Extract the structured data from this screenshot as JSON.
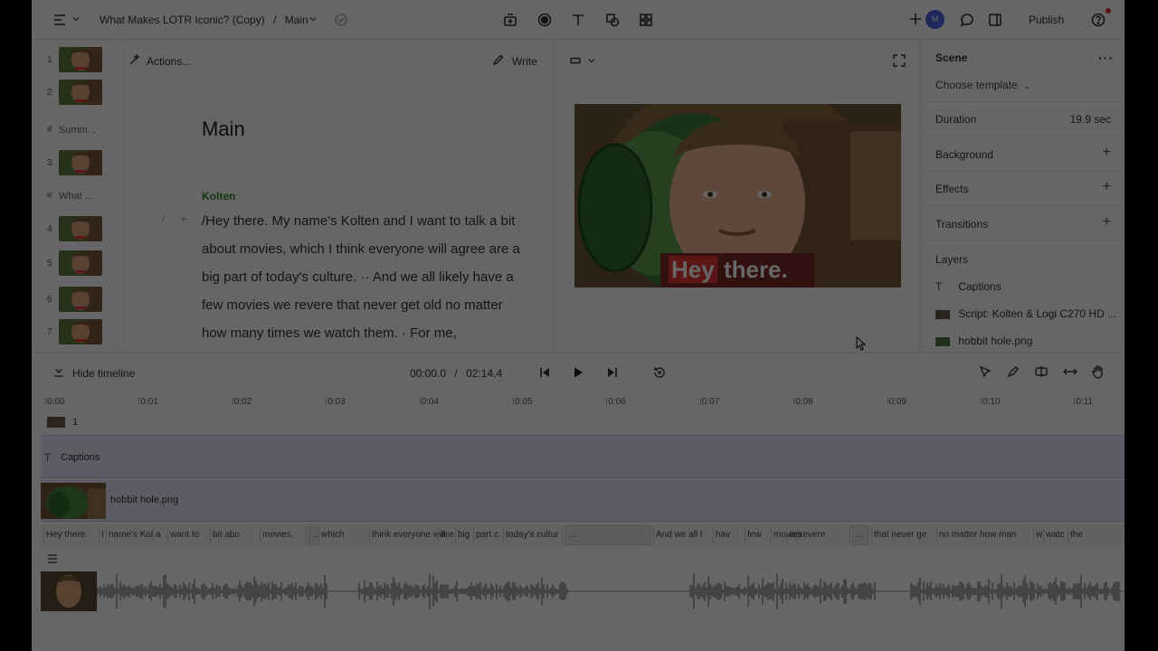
{
  "topbar": {
    "project_title": "What Makes LOTR Iconic? (Copy)",
    "separator": "/",
    "composition": "Main",
    "avatar_initial": "M",
    "publish_label": "Publish"
  },
  "thumbnails": [
    {
      "num": "1",
      "kind": "frame"
    },
    {
      "num": "2",
      "kind": "frame"
    },
    {
      "num": "#",
      "kind": "marker",
      "label": "Summ..."
    },
    {
      "num": "3",
      "kind": "frame"
    },
    {
      "num": "#",
      "kind": "marker",
      "label": "What ..."
    },
    {
      "num": "4",
      "kind": "frame"
    },
    {
      "num": "5",
      "kind": "frame"
    },
    {
      "num": "6",
      "kind": "frame"
    },
    {
      "num": "7",
      "kind": "frame"
    }
  ],
  "script": {
    "actions_label": "Actions...",
    "write_label": "Write",
    "heading": "Main",
    "speaker": "Kolten",
    "paragraph": "/Hey there. My name's Kolten and I want to talk a bit about movies, which I think everyone will agree are a big part of today's culture. ·· And we all likely have a few movies we revere that never get old no matter how many times we watch them. · For me,"
  },
  "preview": {
    "caption_highlight": "Hey",
    "caption_rest": "there."
  },
  "properties": {
    "scene_title": "Scene",
    "template_label": "Choose template",
    "duration_label": "Duration",
    "duration_value": "19.9 sec",
    "background_label": "Background",
    "effects_label": "Effects",
    "transitions_label": "Transitions",
    "layers_title": "Layers",
    "layers": [
      {
        "label": "Captions"
      },
      {
        "label": "Script: Kolten & Logi C270 HD ..."
      },
      {
        "label": "hobbit hole.png"
      }
    ]
  },
  "timeline": {
    "hide_label": "Hide timeline",
    "current_time": "00:00.0",
    "time_separator": "/",
    "total_time": "02:14.4",
    "ruler": [
      "0:00",
      "0:01",
      "0:02",
      "0:03",
      "0:04",
      "0:05",
      "0:06",
      "0:07",
      "0:08",
      "0:09",
      "0:10",
      "0:11"
    ],
    "scene_number": "1",
    "captions_track_label": "Captions",
    "image_track_label": "hobbit hole.png",
    "words": [
      "Hey there.",
      "I",
      "name's Kol",
      "a",
      "want to",
      "bit abo",
      "movies,",
      "...",
      "which",
      "think everyone will",
      "are",
      "big",
      "part c",
      "today's cultur",
      "...",
      "And we all l",
      "hav",
      "few",
      "movies",
      "we",
      "revere",
      "...",
      "that never ge",
      "no matter how man",
      "w",
      "watc",
      "the"
    ]
  },
  "colors": {
    "accent_purple": "#e8e4fb",
    "speaker_green": "#2e8b2e",
    "caption_red": "#e53935",
    "notification_red": "#e53935",
    "avatar_blue": "#4a63e0"
  }
}
